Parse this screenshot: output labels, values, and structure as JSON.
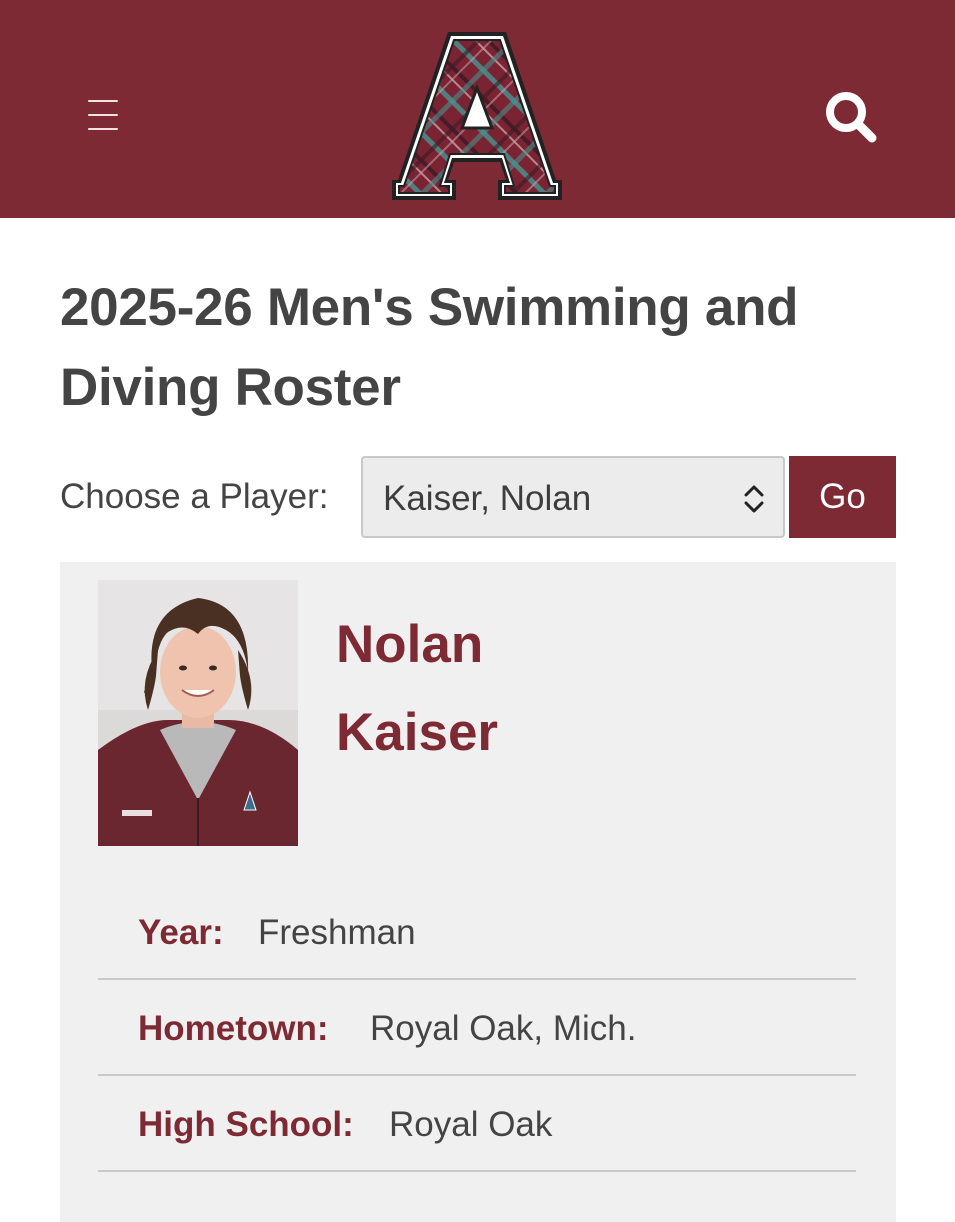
{
  "header": {
    "menu_icon": "hamburger-menu-icon",
    "logo": "plaid-letter-a-logo",
    "search_icon": "search-icon",
    "background_color": "#7d2a35"
  },
  "page": {
    "title": "2025-26 Men's Swimming and Diving Roster"
  },
  "player_chooser": {
    "label": "Choose a Player:",
    "selected": "Kaiser, Nolan",
    "go_label": "Go"
  },
  "player": {
    "first_name": "Nolan",
    "last_name": "Kaiser",
    "photo": "player-headshot",
    "details": [
      {
        "label": "Year:",
        "value": "Freshman"
      },
      {
        "label": "Hometown:",
        "value": "Royal Oak, Mich."
      },
      {
        "label": "High School:",
        "value": "Royal Oak"
      }
    ]
  },
  "colors": {
    "accent": "#7d2a35",
    "text": "#444444",
    "card_background": "#f1f0f1"
  }
}
